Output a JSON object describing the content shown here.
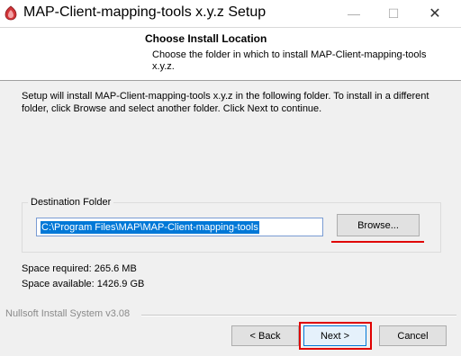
{
  "window": {
    "title": "MAP-Client-mapping-tools x.y.z Setup",
    "controls": {
      "minimize": "—",
      "maximize": "☐",
      "close": "✕"
    }
  },
  "header": {
    "title": "Choose Install Location",
    "subtitle": "Choose the folder in which to install MAP-Client-mapping-tools x.y.z."
  },
  "body": {
    "intro": "Setup will install MAP-Client-mapping-tools  x.y.z   in the following folder. To install in a different folder, click Browse and select another folder. Click Next to continue."
  },
  "destination": {
    "label": "Destination Folder",
    "value": "C:\\Program Files\\MAP\\MAP-Client-mapping-tools",
    "browse_label": "Browse..."
  },
  "space": {
    "required": "Space required: 265.6 MB",
    "available": "Space available: 1426.9 GB"
  },
  "footer": {
    "branding": "Nullsoft Install System v3.08",
    "back_label": "< Back",
    "next_label": "Next >",
    "cancel_label": "Cancel"
  },
  "colors": {
    "accent": "#0078d7",
    "highlight_annotation": "#e00000",
    "icon_red": "#d13438"
  }
}
